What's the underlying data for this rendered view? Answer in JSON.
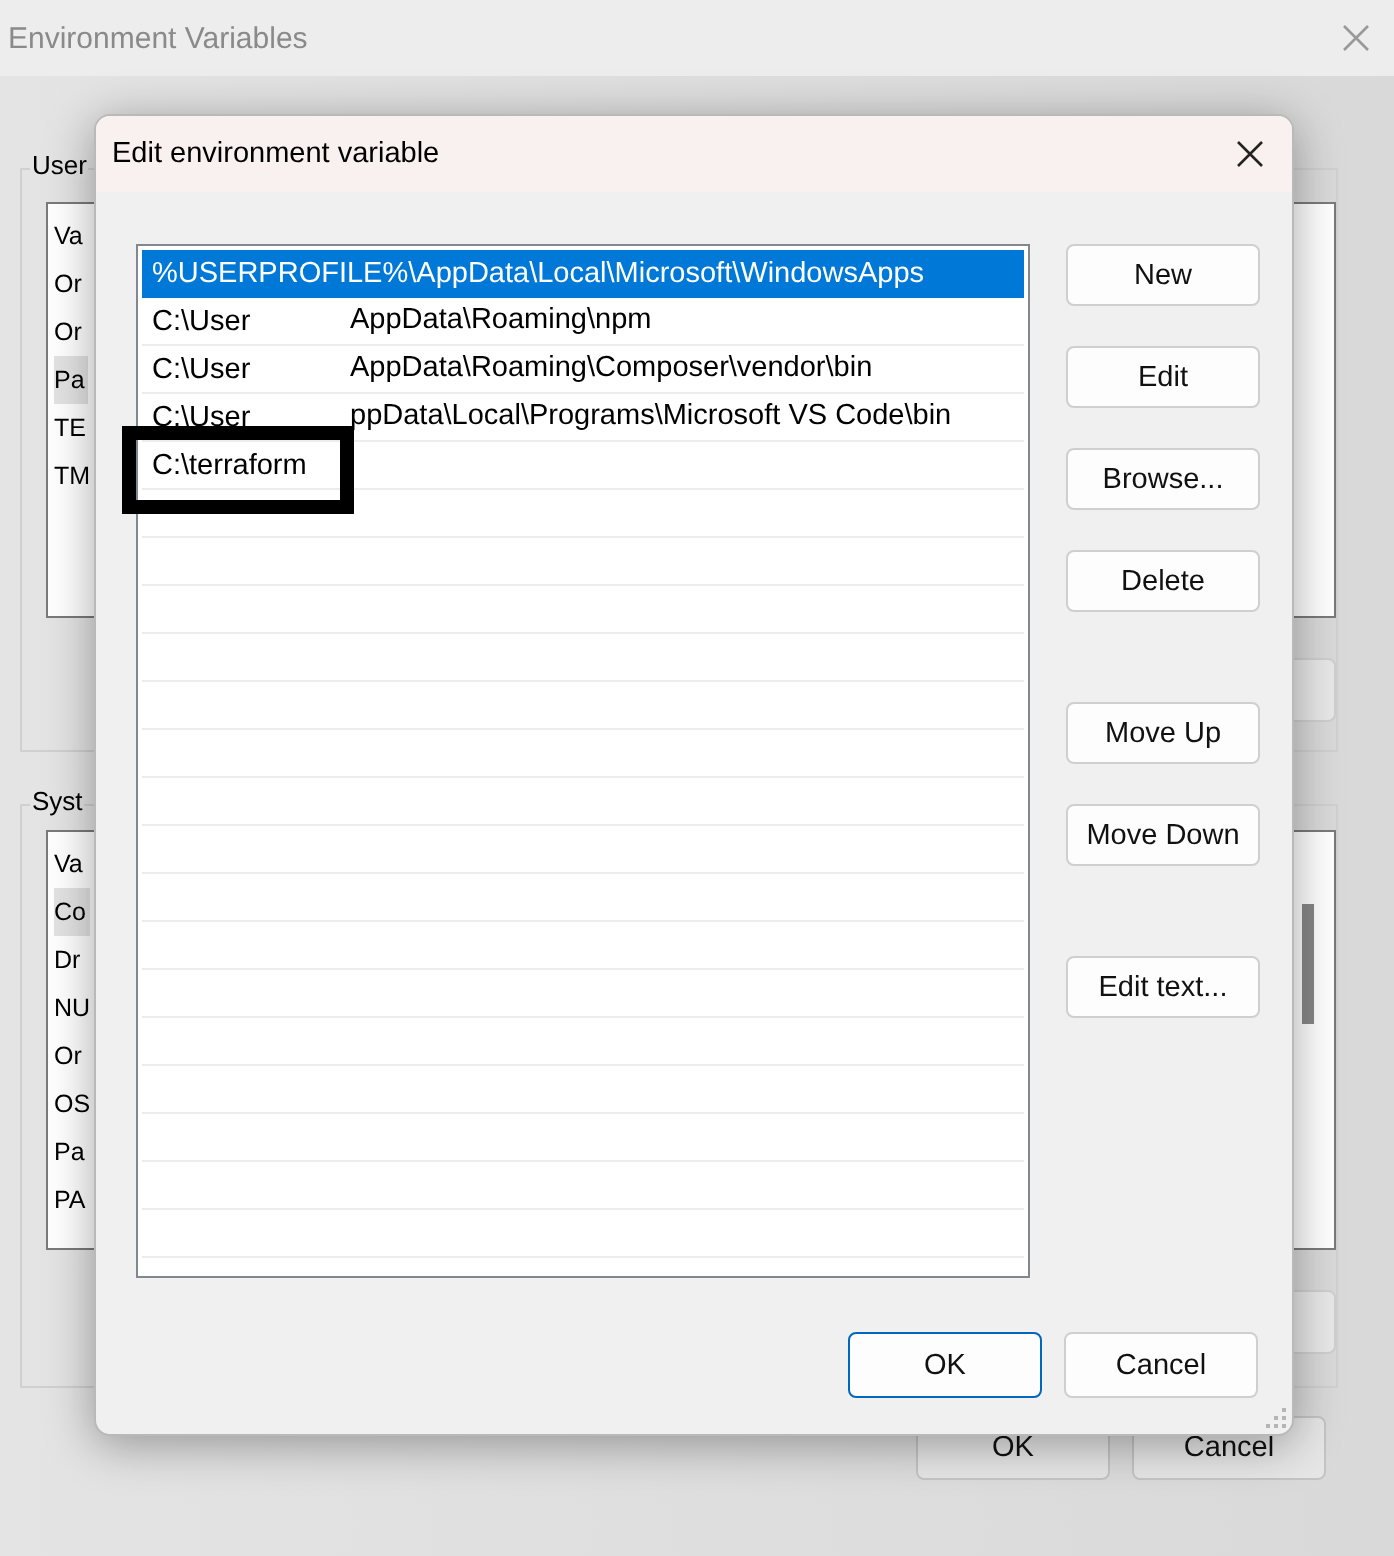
{
  "background_window": {
    "title": "Environment Variables",
    "user_variables": {
      "label": "User",
      "header": "Va",
      "rows": [
        {
          "text": "Or",
          "selected": false
        },
        {
          "text": "Or",
          "selected": false
        },
        {
          "text": "Pa",
          "selected": true
        },
        {
          "text": "TE",
          "selected": false
        },
        {
          "text": "TM",
          "selected": false
        }
      ]
    },
    "system_variables": {
      "label": "Syst",
      "header": "Va",
      "rows": [
        {
          "text": "Co",
          "selected": true
        },
        {
          "text": "Dr",
          "selected": false
        },
        {
          "text": "NU",
          "selected": false
        },
        {
          "text": "Or",
          "selected": false
        },
        {
          "text": "OS",
          "selected": false
        },
        {
          "text": "Pa",
          "selected": false
        },
        {
          "text": "PA",
          "selected": false
        }
      ]
    },
    "buttons": [
      "OK",
      "Cancel"
    ]
  },
  "dialog": {
    "title": "Edit environment variable",
    "entries": [
      {
        "text": "%USERPROFILE%\\AppData\\Local\\Microsoft\\WindowsApps",
        "selected": true,
        "highlighted": false
      },
      {
        "text": "C:\\User",
        "rest": "AppData\\Roaming\\npm",
        "selected": false,
        "highlighted": false
      },
      {
        "text": "C:\\User",
        "rest": "AppData\\Roaming\\Composer\\vendor\\bin",
        "selected": false,
        "highlighted": false
      },
      {
        "text": "C:\\User",
        "rest": "ppData\\Local\\Programs\\Microsoft VS Code\\bin",
        "selected": false,
        "highlighted": false
      },
      {
        "text": "C:\\terraform",
        "selected": false,
        "highlighted": true
      }
    ],
    "button_groups": [
      [
        "New",
        "Edit",
        "Browse...",
        "Delete"
      ],
      [
        "Move Up",
        "Move Down"
      ],
      [
        "Edit text..."
      ]
    ],
    "footer_buttons": [
      {
        "label": "OK",
        "default": true
      },
      {
        "label": "Cancel",
        "default": false
      }
    ]
  }
}
